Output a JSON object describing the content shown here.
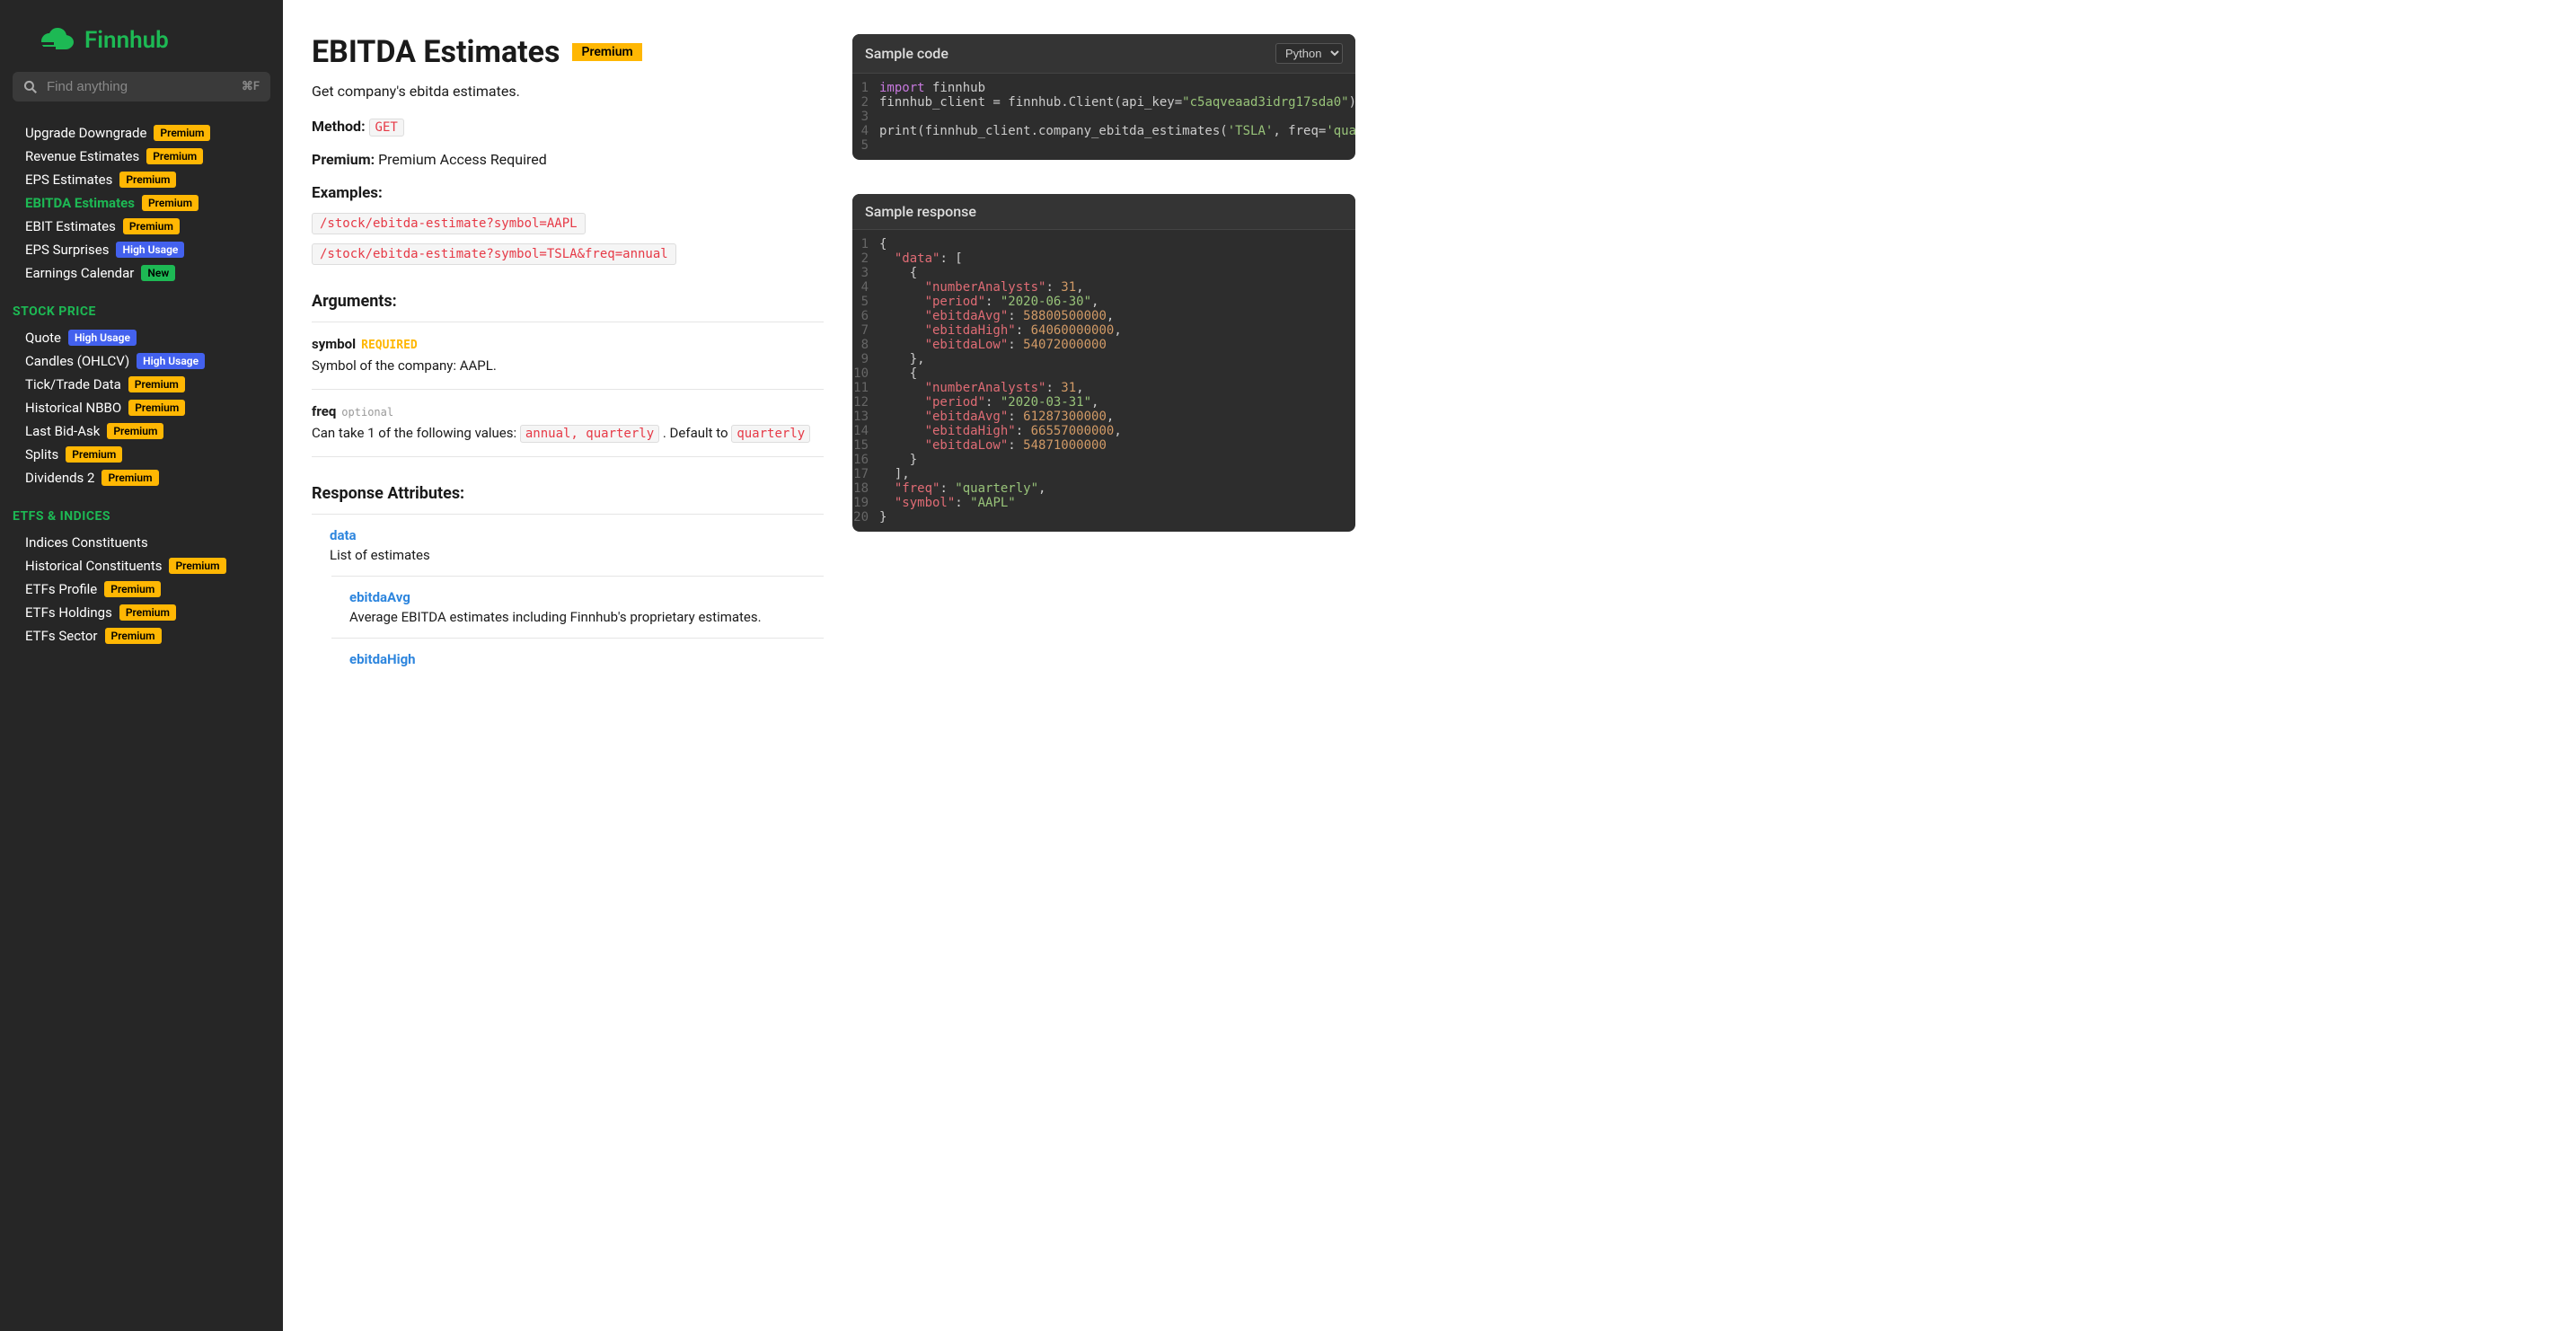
{
  "brand": "Finnhub",
  "search": {
    "placeholder": "Find anything",
    "shortcut": "⌘F"
  },
  "nav": {
    "items": [
      {
        "label": "Upgrade Downgrade",
        "badge": "Premium",
        "badgeType": "premium"
      },
      {
        "label": "Revenue Estimates",
        "badge": "Premium",
        "badgeType": "premium"
      },
      {
        "label": "EPS Estimates",
        "badge": "Premium",
        "badgeType": "premium"
      },
      {
        "label": "EBITDA Estimates",
        "badge": "Premium",
        "badgeType": "premium",
        "active": true
      },
      {
        "label": "EBIT Estimates",
        "badge": "Premium",
        "badgeType": "premium"
      },
      {
        "label": "EPS Surprises",
        "badge": "High Usage",
        "badgeType": "high"
      },
      {
        "label": "Earnings Calendar",
        "badge": "New",
        "badgeType": "new"
      }
    ],
    "sections": [
      {
        "title": "STOCK PRICE",
        "items": [
          {
            "label": "Quote",
            "badge": "High Usage",
            "badgeType": "high"
          },
          {
            "label": "Candles (OHLCV)",
            "badge": "High Usage",
            "badgeType": "high"
          },
          {
            "label": "Tick/Trade Data",
            "badge": "Premium",
            "badgeType": "premium"
          },
          {
            "label": "Historical NBBO",
            "badge": "Premium",
            "badgeType": "premium"
          },
          {
            "label": "Last Bid-Ask",
            "badge": "Premium",
            "badgeType": "premium"
          },
          {
            "label": "Splits",
            "badge": "Premium",
            "badgeType": "premium"
          },
          {
            "label": "Dividends 2",
            "badge": "Premium",
            "badgeType": "premium"
          }
        ]
      },
      {
        "title": "ETFS & INDICES",
        "items": [
          {
            "label": "Indices Constituents"
          },
          {
            "label": "Historical Constituents",
            "badge": "Premium",
            "badgeType": "premium"
          },
          {
            "label": "ETFs Profile",
            "badge": "Premium",
            "badgeType": "premium"
          },
          {
            "label": "ETFs Holdings",
            "badge": "Premium",
            "badgeType": "premium"
          },
          {
            "label": "ETFs Sector",
            "badge": "Premium",
            "badgeType": "premium"
          }
        ]
      }
    ]
  },
  "page": {
    "title": "EBITDA Estimates",
    "title_badge": "Premium",
    "description": "Get company's ebitda estimates.",
    "method_label": "Method:",
    "method_value": "GET",
    "premium_label": "Premium:",
    "premium_value": "Premium Access Required",
    "examples_label": "Examples:",
    "examples": [
      "/stock/ebitda-estimate?symbol=AAPL",
      "/stock/ebitda-estimate?symbol=TSLA&freq=annual"
    ],
    "arguments_label": "Arguments:",
    "arguments": [
      {
        "name": "symbol",
        "tag": "REQUIRED",
        "tagType": "req",
        "desc": "Symbol of the company: AAPL."
      },
      {
        "name": "freq",
        "tag": "optional",
        "tagType": "opt",
        "desc_pre": "Can take 1 of the following values: ",
        "code": "annual, quarterly",
        "desc_post": " . Default to ",
        "code2": "quarterly"
      }
    ],
    "response_label": "Response Attributes:",
    "resp": [
      {
        "name": "data",
        "desc": "List of estimates",
        "nested": false
      },
      {
        "name": "ebitdaAvg",
        "desc": "Average EBITDA estimates including Finnhub's proprietary estimates.",
        "nested": true
      },
      {
        "name": "ebitdaHigh",
        "desc": "",
        "nested": true
      }
    ]
  },
  "code_panel": {
    "title": "Sample code",
    "lang": "Python",
    "lines": [
      [
        {
          "t": "kw",
          "v": "import"
        },
        {
          "t": "",
          "v": " finnhub"
        }
      ],
      [
        {
          "t": "",
          "v": "finnhub_client = finnhub.Client(api_key="
        },
        {
          "t": "str",
          "v": "\"c5aqveaad3idrg17sda0\""
        },
        {
          "t": "",
          "v": ")"
        }
      ],
      [],
      [
        {
          "t": "",
          "v": "print(finnhub_client.company_ebitda_estimates("
        },
        {
          "t": "str",
          "v": "'TSLA'"
        },
        {
          "t": "",
          "v": ", freq="
        },
        {
          "t": "str",
          "v": "'quar"
        }
      ],
      []
    ]
  },
  "resp_panel": {
    "title": "Sample response",
    "lines": [
      [
        {
          "t": "",
          "v": "{"
        }
      ],
      [
        {
          "t": "",
          "v": "  "
        },
        {
          "t": "key",
          "v": "\"data\""
        },
        {
          "t": "",
          "v": ": ["
        }
      ],
      [
        {
          "t": "",
          "v": "    {"
        }
      ],
      [
        {
          "t": "",
          "v": "      "
        },
        {
          "t": "key",
          "v": "\"numberAnalysts\""
        },
        {
          "t": "",
          "v": ": "
        },
        {
          "t": "num",
          "v": "31"
        },
        {
          "t": "",
          "v": ","
        }
      ],
      [
        {
          "t": "",
          "v": "      "
        },
        {
          "t": "key",
          "v": "\"period\""
        },
        {
          "t": "",
          "v": ": "
        },
        {
          "t": "str",
          "v": "\"2020-06-30\""
        },
        {
          "t": "",
          "v": ","
        }
      ],
      [
        {
          "t": "",
          "v": "      "
        },
        {
          "t": "key",
          "v": "\"ebitdaAvg\""
        },
        {
          "t": "",
          "v": ": "
        },
        {
          "t": "num",
          "v": "58800500000"
        },
        {
          "t": "",
          "v": ","
        }
      ],
      [
        {
          "t": "",
          "v": "      "
        },
        {
          "t": "key",
          "v": "\"ebitdaHigh\""
        },
        {
          "t": "",
          "v": ": "
        },
        {
          "t": "num",
          "v": "64060000000"
        },
        {
          "t": "",
          "v": ","
        }
      ],
      [
        {
          "t": "",
          "v": "      "
        },
        {
          "t": "key",
          "v": "\"ebitdaLow\""
        },
        {
          "t": "",
          "v": ": "
        },
        {
          "t": "num",
          "v": "54072000000"
        }
      ],
      [
        {
          "t": "",
          "v": "    },"
        }
      ],
      [
        {
          "t": "",
          "v": "    {"
        }
      ],
      [
        {
          "t": "",
          "v": "      "
        },
        {
          "t": "key",
          "v": "\"numberAnalysts\""
        },
        {
          "t": "",
          "v": ": "
        },
        {
          "t": "num",
          "v": "31"
        },
        {
          "t": "",
          "v": ","
        }
      ],
      [
        {
          "t": "",
          "v": "      "
        },
        {
          "t": "key",
          "v": "\"period\""
        },
        {
          "t": "",
          "v": ": "
        },
        {
          "t": "str",
          "v": "\"2020-03-31\""
        },
        {
          "t": "",
          "v": ","
        }
      ],
      [
        {
          "t": "",
          "v": "      "
        },
        {
          "t": "key",
          "v": "\"ebitdaAvg\""
        },
        {
          "t": "",
          "v": ": "
        },
        {
          "t": "num",
          "v": "61287300000"
        },
        {
          "t": "",
          "v": ","
        }
      ],
      [
        {
          "t": "",
          "v": "      "
        },
        {
          "t": "key",
          "v": "\"ebitdaHigh\""
        },
        {
          "t": "",
          "v": ": "
        },
        {
          "t": "num",
          "v": "66557000000"
        },
        {
          "t": "",
          "v": ","
        }
      ],
      [
        {
          "t": "",
          "v": "      "
        },
        {
          "t": "key",
          "v": "\"ebitdaLow\""
        },
        {
          "t": "",
          "v": ": "
        },
        {
          "t": "num",
          "v": "54871000000"
        }
      ],
      [
        {
          "t": "",
          "v": "    }"
        }
      ],
      [
        {
          "t": "",
          "v": "  ],"
        }
      ],
      [
        {
          "t": "",
          "v": "  "
        },
        {
          "t": "key",
          "v": "\"freq\""
        },
        {
          "t": "",
          "v": ": "
        },
        {
          "t": "str",
          "v": "\"quarterly\""
        },
        {
          "t": "",
          "v": ","
        }
      ],
      [
        {
          "t": "",
          "v": "  "
        },
        {
          "t": "key",
          "v": "\"symbol\""
        },
        {
          "t": "",
          "v": ": "
        },
        {
          "t": "str",
          "v": "\"AAPL\""
        }
      ],
      [
        {
          "t": "",
          "v": "}"
        }
      ]
    ]
  }
}
